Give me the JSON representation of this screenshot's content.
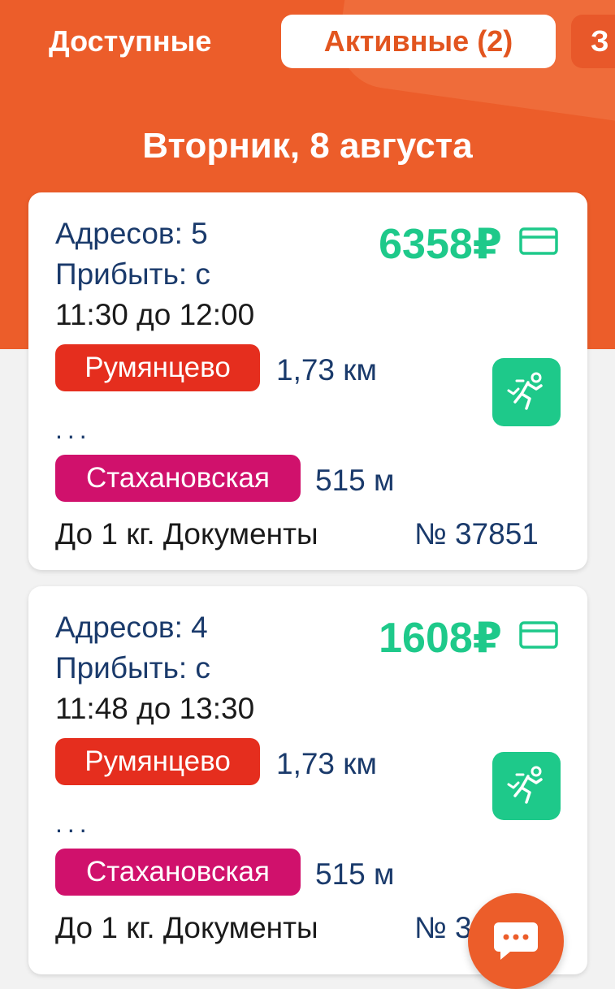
{
  "tabs": {
    "available": "Доступные",
    "active": "Активные (2)",
    "third": "З"
  },
  "date_title": "Вторник, 8 августа",
  "orders": [
    {
      "addresses": "Адресов: 5",
      "arrive_prefix": "Прибыть: с",
      "arrive_time": "11:30 до 12:00",
      "price": "6358₽",
      "stop_from": "Румянцево",
      "stop_from_dist": "1,73 км",
      "dots": "...",
      "stop_to": "Стахановская",
      "stop_to_dist": "515 м",
      "weight": "До 1 кг. Документы",
      "number": "№ 37851"
    },
    {
      "addresses": "Адресов: 4",
      "arrive_prefix": "Прибыть: с",
      "arrive_time": "11:48 до 13:30",
      "price": "1608₽",
      "stop_from": "Румянцево",
      "stop_from_dist": "1,73 км",
      "dots": "...",
      "stop_to": "Стахановская",
      "stop_to_dist": "515 м",
      "weight": "До 1 кг. Документы",
      "number": "№ 3"
    }
  ],
  "icons": {
    "payment": "credit-card-icon",
    "delivery_type": "runner-icon",
    "chat": "chat-bubble-icon"
  },
  "colors": {
    "brand_orange": "#ec5d2a",
    "price_green": "#1ec98a",
    "badge_red": "#e52e1e",
    "badge_magenta": "#d0116c",
    "text_navy": "#1a3a6b"
  }
}
